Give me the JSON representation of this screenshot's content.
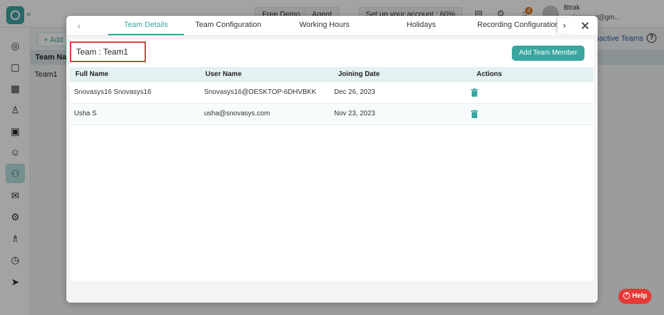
{
  "topbar": {
    "free_demo": "Free Demo",
    "agent": "Agent",
    "setup": "Set up your account : 60%",
    "notif_count": "4",
    "user_name": "Btrak",
    "user_email": "...elopment@gm..."
  },
  "background": {
    "add_label": "+ Add",
    "inactive_teams": "nactive Teams",
    "help_q": "?",
    "col_team_name": "Team Nam",
    "row_team": "Team1"
  },
  "modal": {
    "tabs": [
      {
        "label": "Team Details"
      },
      {
        "label": "Team Configuration"
      },
      {
        "label": "Working Hours"
      },
      {
        "label": "Holidays"
      },
      {
        "label": "Recording Configuration"
      }
    ],
    "prev_icon": "‹",
    "next_icon": "›",
    "close_icon": "✕",
    "team_title": "Team : Team1",
    "add_member_label": "Add Team Member",
    "columns": [
      "Full Name",
      "User Name",
      "Joining Date",
      "Actions"
    ],
    "rows": [
      {
        "full_name": "Snovasys16 Snovasys16",
        "user_name": "Snovasys16@DESKTOP-6DHVBKK",
        "joining_date": "Dec 26, 2023"
      },
      {
        "full_name": "Usha S",
        "user_name": "usha@snovasys.com",
        "joining_date": "Nov 23, 2023"
      }
    ]
  },
  "help_label": "Help",
  "colors": {
    "accent": "#3aa6a0",
    "danger": "#e03a3a",
    "help": "#e53935"
  },
  "icons": {
    "sidebar": [
      "dashboard-icon",
      "calendar-icon",
      "timesheet-icon",
      "user-icon",
      "briefcase-icon",
      "users-icon",
      "teams-icon",
      "mail-icon",
      "settings-icon",
      "badge-user-icon",
      "alarm-icon",
      "send-icon"
    ],
    "row_action": "trash-icon"
  }
}
